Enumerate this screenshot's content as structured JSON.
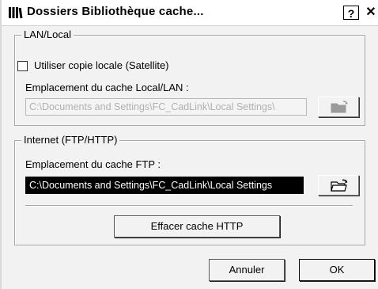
{
  "window": {
    "title": "Dossiers Bibliothèque cache...",
    "help_label": "?",
    "close_label": "✕"
  },
  "lan_group": {
    "legend": "LAN/Local",
    "checkbox_label": "Utiliser copie locale (Satellite)",
    "checkbox_checked": false,
    "location_label": "Emplacement du cache Local/LAN :",
    "location_value": "C:\\Documents and Settings\\FC_CadLink\\Local Settings\\",
    "location_enabled": false
  },
  "internet_group": {
    "legend": "Internet (FTP/HTTP)",
    "location_label": "Emplacement du cache FTP :",
    "location_value": "C:\\Documents and Settings\\FC_CadLink\\Local Settings",
    "clear_button": "Effacer cache HTTP"
  },
  "buttons": {
    "cancel": "Annuler",
    "ok": "OK"
  },
  "icons": {
    "title": "library-books-icon",
    "browse": "open-folder-icon"
  }
}
